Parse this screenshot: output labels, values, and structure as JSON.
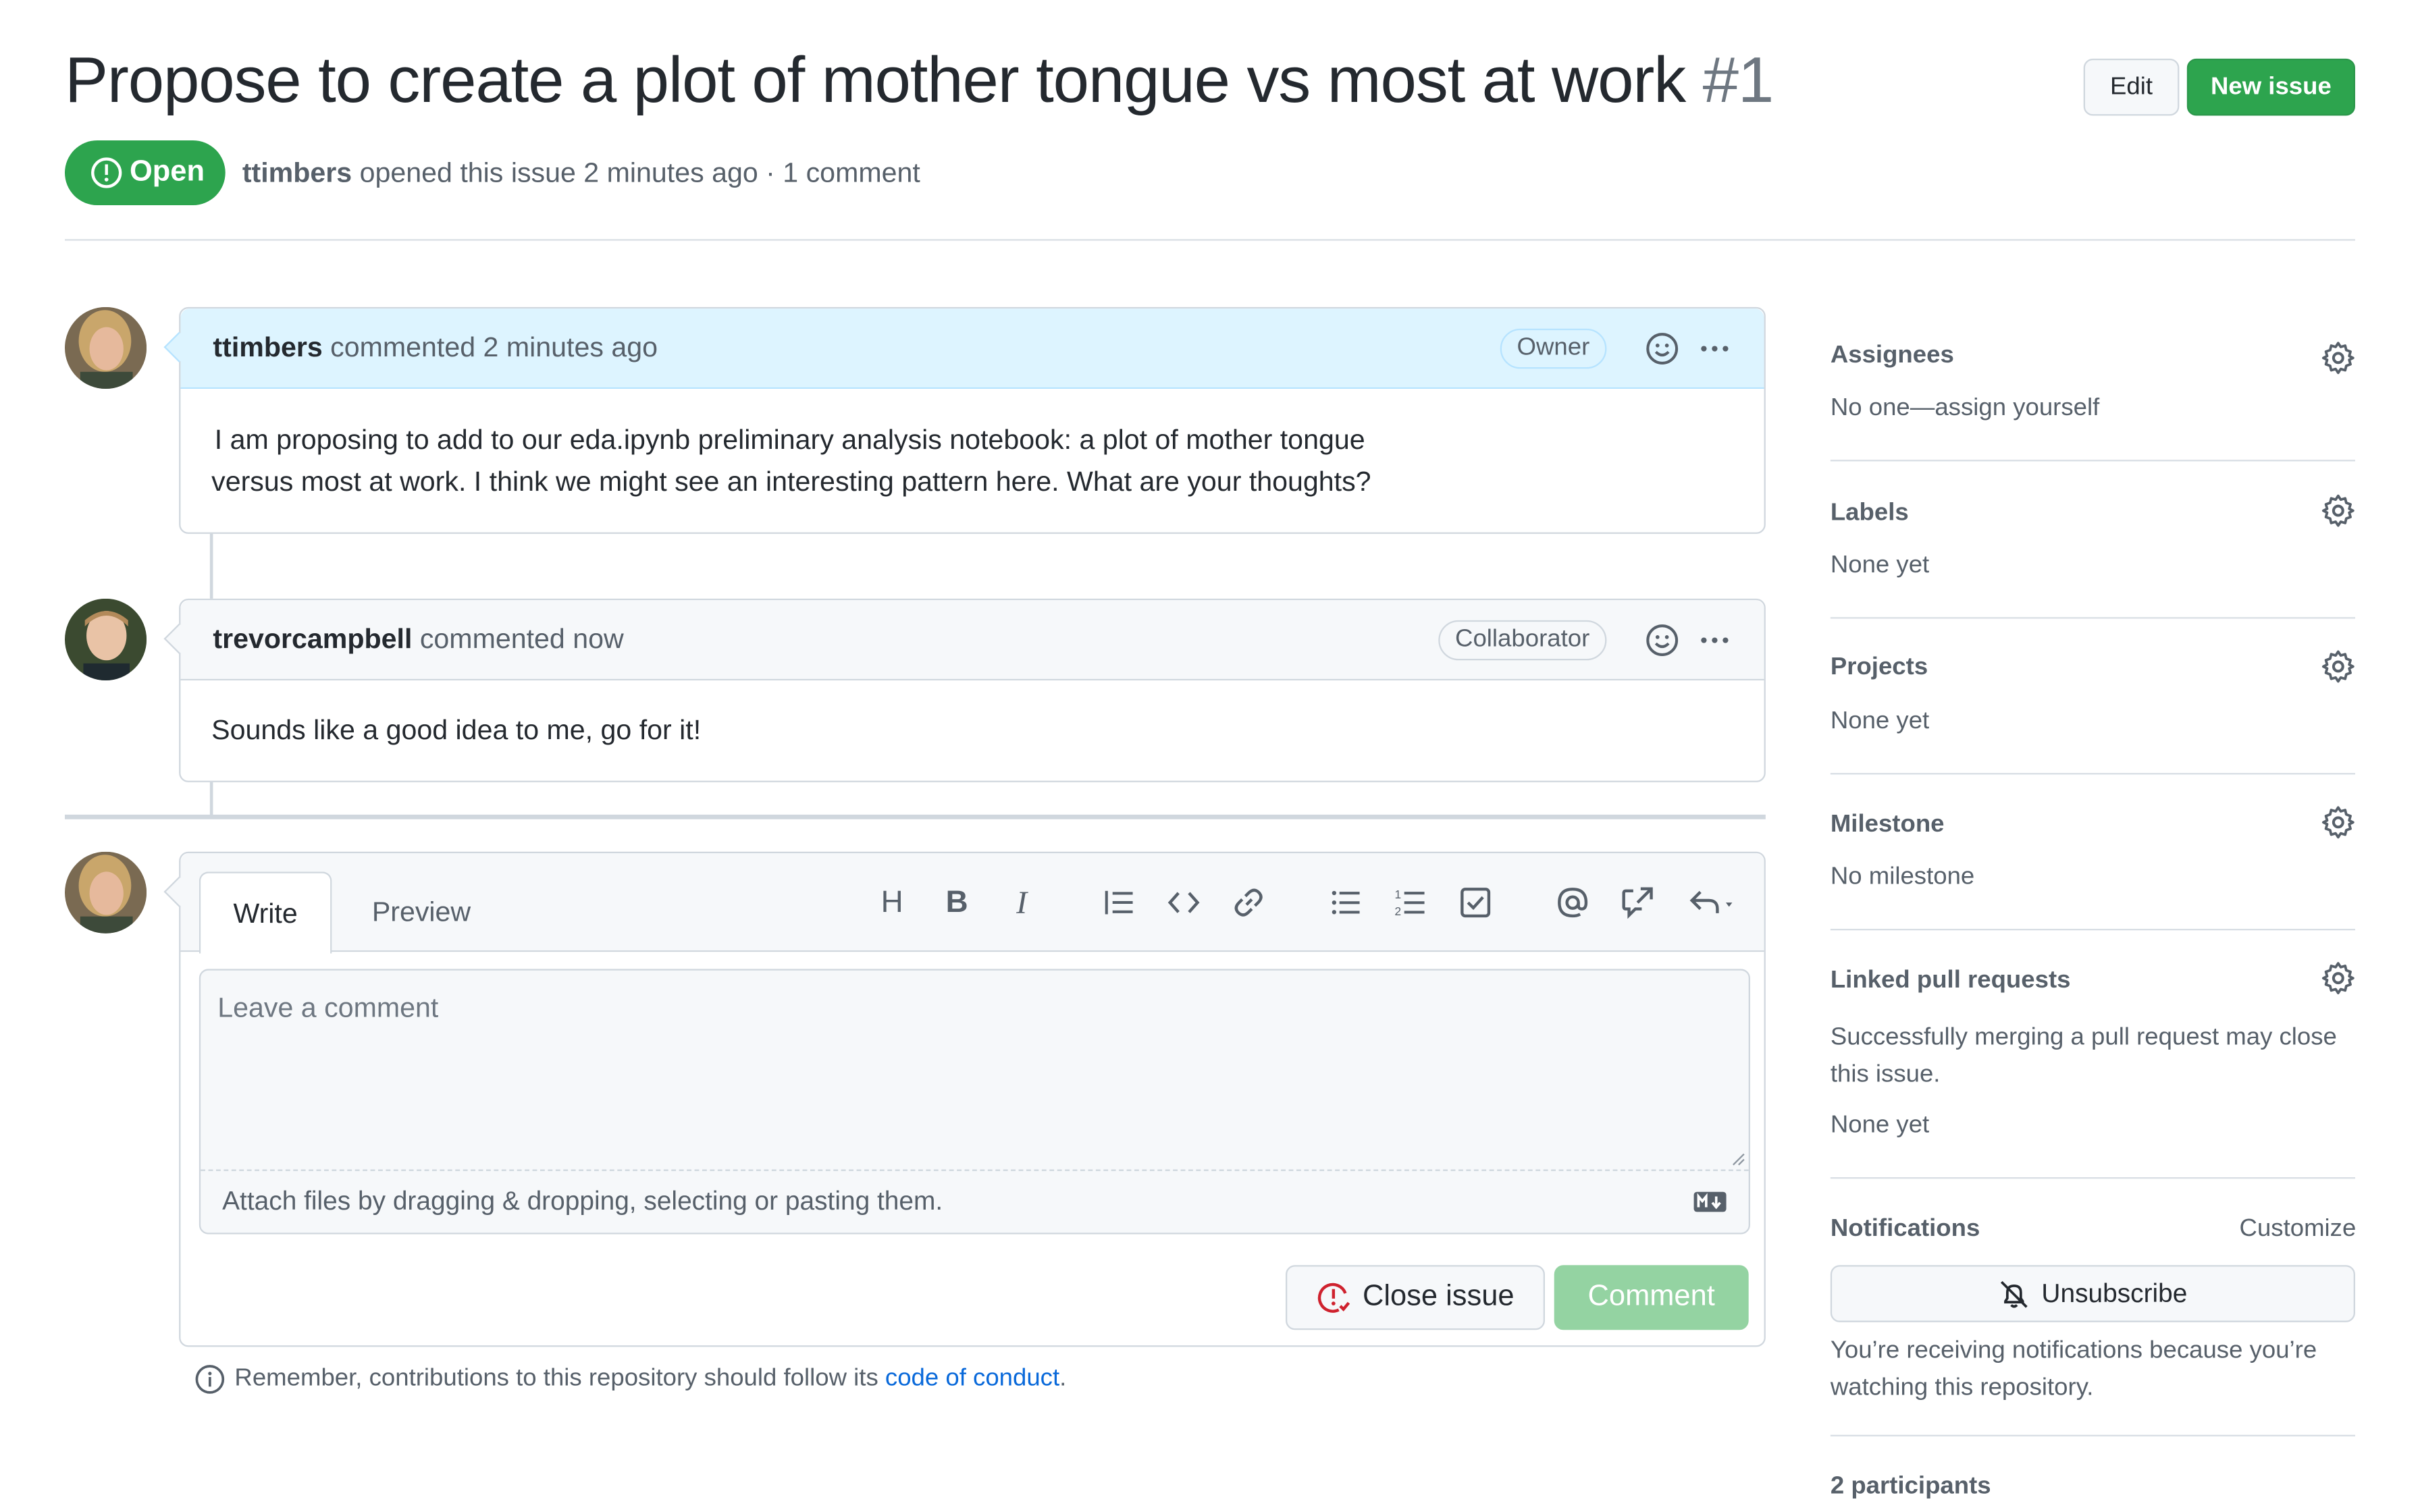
{
  "issue": {
    "title": "Propose to create a plot of mother tongue vs most at work",
    "number": "#1",
    "state": "Open",
    "author": "ttimbers",
    "meta_text": "opened this issue 2 minutes ago · 1 comment"
  },
  "header": {
    "edit_label": "Edit",
    "new_issue_label": "New issue"
  },
  "comments": [
    {
      "author": "ttimbers",
      "time": "commented 2 minutes ago",
      "badge": "Owner",
      "body_line1": "I am proposing to add to our eda.ipynb preliminary analysis notebook: a plot of mother tongue",
      "body_line2": "versus most at work. I think we might see an interesting pattern here. What are your thoughts?"
    },
    {
      "author": "trevorcampbell",
      "time": "commented now",
      "badge": "Collaborator",
      "body": "Sounds like a good idea to me, go for it!"
    }
  ],
  "editor": {
    "tab_write": "Write",
    "tab_preview": "Preview",
    "placeholder": "Leave a comment",
    "attach_text": "Attach files by dragging & dropping, selecting or pasting them.",
    "close_label": "Close issue",
    "comment_label": "Comment",
    "remember_text": "Remember, contributions to this repository should follow its",
    "conduct_link": "code of conduct",
    "tool_heading": "H",
    "tool_bold": "B",
    "tool_italic": "I"
  },
  "sidebar": {
    "assignees_title": "Assignees",
    "assignees_value": "No one—assign yourself",
    "labels_title": "Labels",
    "labels_value": "None yet",
    "projects_title": "Projects",
    "projects_value": "None yet",
    "milestone_title": "Milestone",
    "milestone_value": "No milestone",
    "linked_title": "Linked pull requests",
    "linked_desc_1": "Successfully merging a pull request may close",
    "linked_desc_2": "this issue.",
    "linked_value": "None yet",
    "notifications_title": "Notifications",
    "customize_label": "Customize",
    "unsubscribe_label": "Unsubscribe",
    "notif_desc_1": "You’re receiving notifications because you’re",
    "notif_desc_2": "watching this repository.",
    "participants": "2 participants"
  },
  "colors": {
    "primary_green": "#2da44e",
    "disabled_green": "#94d3a2",
    "link_blue": "#0969da",
    "danger_red": "#cf222e"
  }
}
